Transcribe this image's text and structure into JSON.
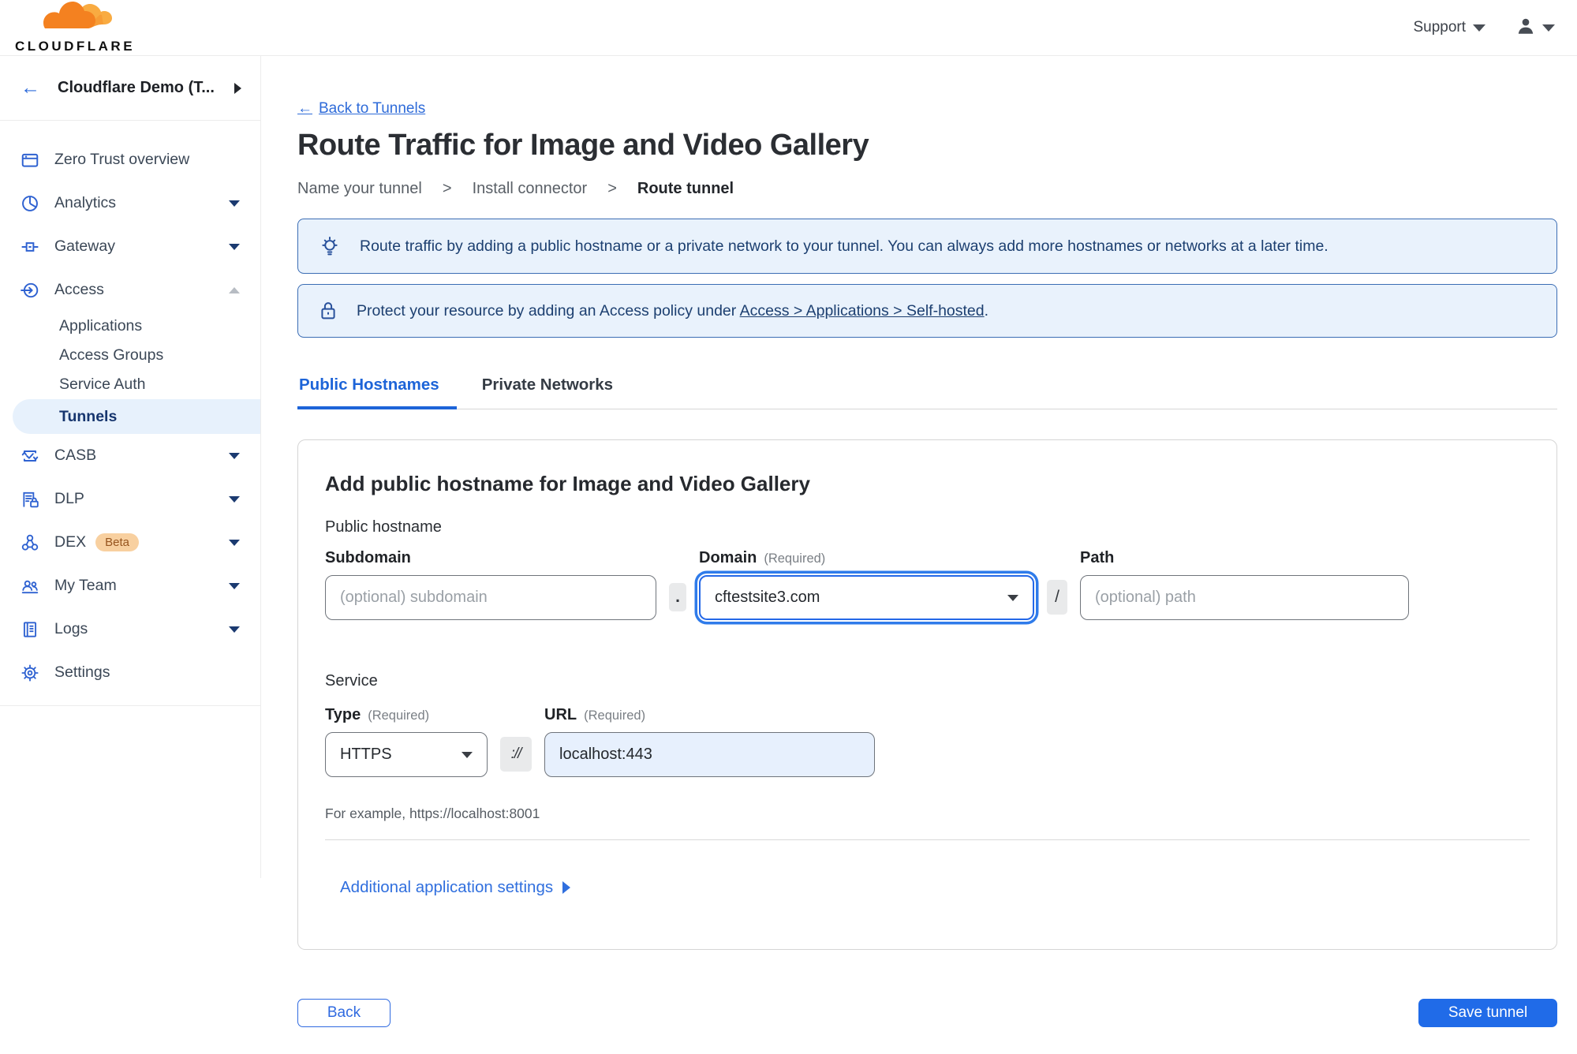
{
  "topbar": {
    "brand": "CLOUDFLARE",
    "support": "Support"
  },
  "sidebar": {
    "account_label": "Cloudflare Demo (T...",
    "items": {
      "overview": "Zero Trust overview",
      "analytics": "Analytics",
      "gateway": "Gateway",
      "access": "Access",
      "applications": "Applications",
      "access_groups": "Access Groups",
      "service_auth": "Service Auth",
      "tunnels": "Tunnels",
      "casb": "CASB",
      "dlp": "DLP",
      "dex": "DEX",
      "dex_badge": "Beta",
      "my_team": "My Team",
      "logs": "Logs",
      "settings": "Settings"
    }
  },
  "main": {
    "back_arrow": "←",
    "back_link": "Back to Tunnels",
    "title": "Route Traffic for Image and Video Gallery",
    "steps": {
      "s1": "Name your tunnel",
      "s2": "Install connector",
      "s3": "Route tunnel",
      "sep": ">"
    },
    "banner_tip": "Route traffic by adding a public hostname or a private network to your tunnel. You can always add more hostnames or networks at a later time.",
    "banner_lock_before": "Protect your resource by adding an Access policy under ",
    "banner_lock_link": "Access > Applications > Self-hosted",
    "banner_lock_after": ".",
    "tabs": {
      "public": "Public Hostnames",
      "private": "Private Networks"
    },
    "form": {
      "heading": "Add public hostname for Image and Video Gallery",
      "group1": "Public hostname",
      "subdomain_label": "Subdomain",
      "subdomain_placeholder": "(optional) subdomain",
      "dot": ".",
      "domain_label": "Domain",
      "required": "(Required)",
      "domain_value": "cftestsite3.com",
      "slash": "/",
      "path_label": "Path",
      "path_placeholder": "(optional) path",
      "group2": "Service",
      "type_label": "Type",
      "type_value": "HTTPS",
      "scheme": "://",
      "url_label": "URL",
      "url_value": "localhost:443",
      "hint": "For example, https://localhost:8001",
      "more_settings": "Additional application settings"
    },
    "footer": {
      "back": "Back",
      "save": "Save tunnel"
    }
  },
  "colors": {
    "accent_blue": "#206be8",
    "link_blue": "#2e6bd9",
    "banner_border": "#3b6db4",
    "banner_bg": "#e9f2fc",
    "active_item_bg": "#e7f1fc",
    "icon_blue": "#2f62d1"
  }
}
